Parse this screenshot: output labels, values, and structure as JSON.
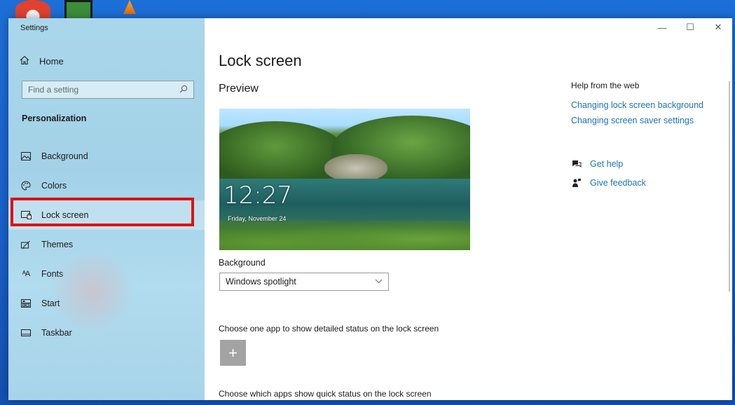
{
  "window": {
    "app_title": "Settings",
    "controls": {
      "minimize": "—",
      "maximize": "☐",
      "close": "✕"
    }
  },
  "sidebar": {
    "home_label": "Home",
    "search_placeholder": "Find a setting",
    "section_title": "Personalization",
    "selected_item": "Lock screen",
    "items": [
      {
        "label": "Background",
        "icon": "image-icon"
      },
      {
        "label": "Colors",
        "icon": "palette-icon"
      },
      {
        "label": "Lock screen",
        "icon": "lock-screen-icon"
      },
      {
        "label": "Themes",
        "icon": "themes-brush-icon"
      },
      {
        "label": "Fonts",
        "icon": "fonts-icon"
      },
      {
        "label": "Start",
        "icon": "start-layout-icon"
      },
      {
        "label": "Taskbar",
        "icon": "taskbar-icon"
      }
    ],
    "highlight_color": "#e01010"
  },
  "main": {
    "page_title": "Lock screen",
    "preview_label": "Preview",
    "preview_time": "12:27",
    "preview_date": "Friday, November 24",
    "background_label": "Background",
    "background_value": "Windows spotlight",
    "detailed_status_label": "Choose one app to show detailed status on the lock screen",
    "add_button": "+",
    "quick_status_label": "Choose which apps show quick status on the lock screen"
  },
  "help": {
    "title": "Help from the web",
    "links": [
      "Changing lock screen background",
      "Changing screen saver settings"
    ],
    "get_help": "Get help",
    "give_feedback": "Give feedback",
    "link_color": "#1d72b8"
  }
}
